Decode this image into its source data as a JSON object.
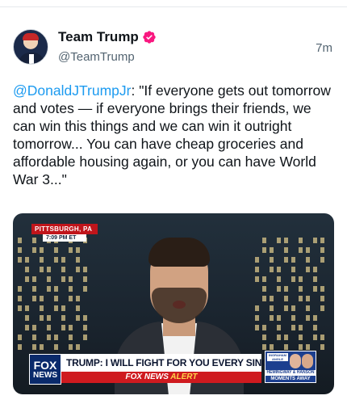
{
  "tweet": {
    "display_name": "Team Trump",
    "handle": "@TeamTrump",
    "timestamp": "7m",
    "mention": "@DonaldJTrumpJr",
    "body": ": \"If everyone gets out tomorrow and votes — if everyone brings their friends, we can win this things and we can win it outright tomorrow... You can have cheap groceries and affordable housing again, or you can have World War 3...\"",
    "verified_icon": "verified-badge-icon",
    "avatar_icon": "avatar-image"
  },
  "video": {
    "location": "PITTSBURGH, PA",
    "time": "7:09 PM ET",
    "network_logo_line1": "FOX",
    "network_logo_line2": "NEWS",
    "headline": "TRUMP: I WILL FIGHT FOR YOU EVERY SINGLE DAY",
    "alert_prefix": "FOX NEWS",
    "alert_word": "ALERT",
    "promo_top": "INGRAHAM ANGLE",
    "promo_sub": "HEMINGWAY & HANSON",
    "promo_bottom": "MOMENTS AWAY"
  },
  "colors": {
    "link": "#1d9bf0",
    "verified": "#f91880",
    "secondary_text": "#536471",
    "chyron_red": "#cf1a1f",
    "fox_blue": "#0a2a6b"
  }
}
